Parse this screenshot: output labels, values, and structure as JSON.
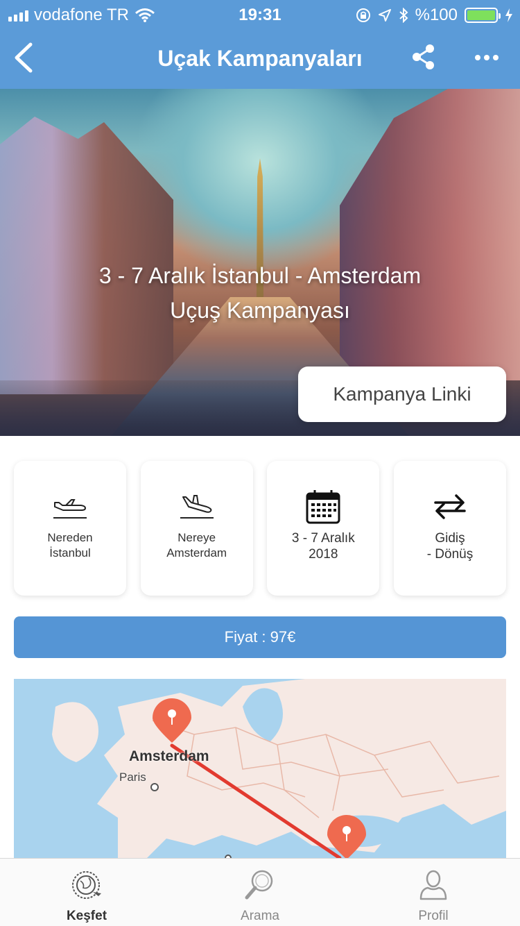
{
  "status_bar": {
    "carrier": "vodafone TR",
    "time": "19:31",
    "battery_text": "%100"
  },
  "nav": {
    "title": "Uçak Kampanyaları",
    "back_icon": "chevron-left-icon",
    "share_icon": "share-icon",
    "more_icon": "more-dots-icon"
  },
  "hero": {
    "headline_line1": "3 - 7 Aralık İstanbul - Amsterdam",
    "headline_line2": "Uçuş Kampanyası",
    "cta_label": "Kampanya Linki"
  },
  "cards": [
    {
      "icon": "plane-takeoff-icon",
      "line1": "Nereden",
      "line2": "İstanbul"
    },
    {
      "icon": "plane-landing-icon",
      "line1": "Nereye",
      "line2": "Amsterdam"
    },
    {
      "icon": "calendar-icon",
      "line1": "3 - 7 Aralık",
      "line2": "2018"
    },
    {
      "icon": "round-trip-icon",
      "line1": "Gidiş",
      "line2": "- Dönüş"
    }
  ],
  "price": {
    "label": "Fiyat : 97€"
  },
  "map": {
    "city_origin_label": "Amsterdam",
    "city_other_label": "Paris",
    "route_color": "#e23a2f",
    "pin_color": "#ef6a4f"
  },
  "tabs": [
    {
      "label": "Keşfet",
      "icon": "globe-plane-icon",
      "active": true
    },
    {
      "label": "Arama",
      "icon": "search-icon",
      "active": false
    },
    {
      "label": "Profil",
      "icon": "user-icon",
      "active": false
    }
  ],
  "colors": {
    "nav_bg": "#5b9bd8",
    "price_bg": "#5595d5",
    "battery": "#7ee05c"
  }
}
